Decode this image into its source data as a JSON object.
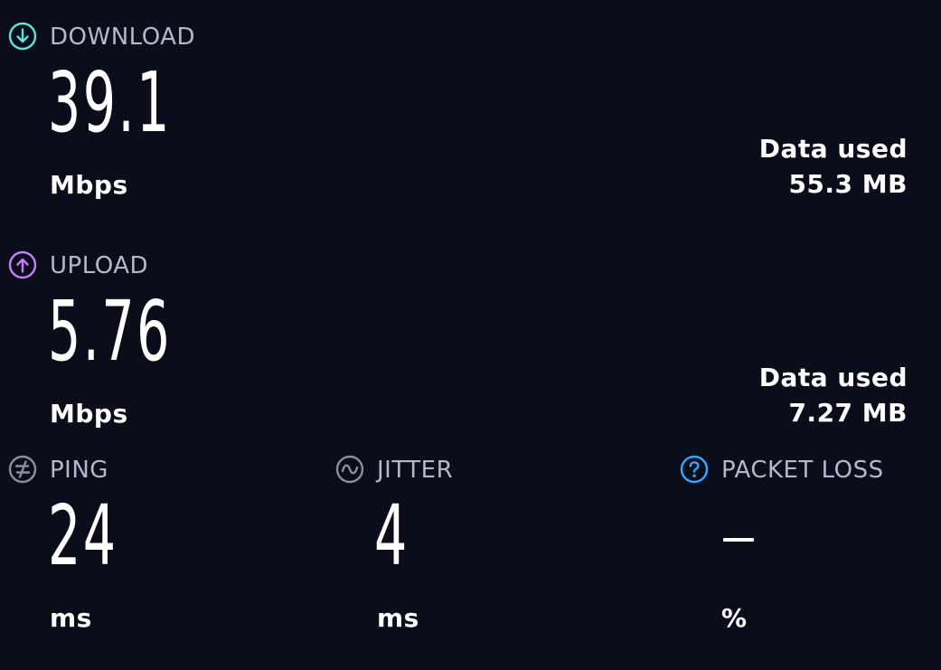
{
  "download": {
    "label": "DOWNLOAD",
    "value": "39.1",
    "unit": "Mbps",
    "data_used_label": "Data used",
    "data_used_value": "55.3 MB",
    "icon": "arrow-down-circle-icon",
    "color": "#5ee3d8"
  },
  "upload": {
    "label": "UPLOAD",
    "value": "5.76",
    "unit": "Mbps",
    "data_used_label": "Data used",
    "data_used_value": "7.27 MB",
    "icon": "arrow-up-circle-icon",
    "color": "#c77dff"
  },
  "ping": {
    "label": "PING",
    "value": "24",
    "unit": "ms",
    "icon": "ping-icon",
    "color": "#8a8f9f"
  },
  "jitter": {
    "label": "JITTER",
    "value": "4",
    "unit": "ms",
    "icon": "jitter-icon",
    "color": "#8a8f9f"
  },
  "packet_loss": {
    "label": "PACKET LOSS",
    "value": "—",
    "unit": "%",
    "icon": "help-circle-icon",
    "color": "#2fa8ff"
  }
}
